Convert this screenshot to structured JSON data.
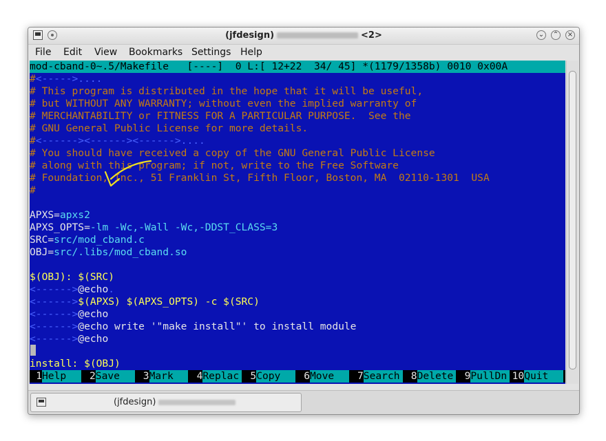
{
  "window": {
    "title_prefix": "(jfdesign)",
    "title_suffix": "<2>"
  },
  "menu": [
    "File",
    "Edit",
    "View",
    "Bookmarks",
    "Settings",
    "Help"
  ],
  "status_line": "mod-cband-0~.5/Makefile   [----]  0 L:[ 12+22  34/ 45] *(1179/1358b) 0010 0x00A",
  "code_lines": [
    [
      {
        "t": "#",
        "c": "org"
      },
      {
        "t": "<----->....",
        "c": "dash"
      }
    ],
    [
      {
        "t": "# This program is distributed in the hope that it will be useful,",
        "c": "org"
      }
    ],
    [
      {
        "t": "# but WITHOUT ANY WARRANTY; without even the implied warranty of",
        "c": "org"
      }
    ],
    [
      {
        "t": "# MERCHANTABILITY or FITNESS FOR A PARTICULAR PURPOSE.  See the",
        "c": "org"
      }
    ],
    [
      {
        "t": "# GNU General Public License for more details.",
        "c": "org"
      }
    ],
    [
      {
        "t": "#",
        "c": "org"
      },
      {
        "t": "<------><------><------>....",
        "c": "dash"
      }
    ],
    [
      {
        "t": "# You should have received a copy of the GNU General Public License",
        "c": "org"
      }
    ],
    [
      {
        "t": "# along with this program; if not, write to the Free Software",
        "c": "org"
      }
    ],
    [
      {
        "t": "# Foundation, Inc., 51 Franklin St, Fifth Floor, Boston, MA  02110-1301  USA",
        "c": "org"
      }
    ],
    [
      {
        "t": "#",
        "c": "org"
      }
    ],
    [],
    [
      {
        "t": "APXS=",
        "c": "white"
      },
      {
        "t": "apxs2",
        "c": "cyan"
      }
    ],
    [
      {
        "t": "APXS_OPTS=",
        "c": "white"
      },
      {
        "t": "-lm -Wc,-Wall -Wc,-DDST_CLASS=3",
        "c": "cyan"
      }
    ],
    [
      {
        "t": "SRC=",
        "c": "white"
      },
      {
        "t": "src/mod_cband.c",
        "c": "cyan"
      }
    ],
    [
      {
        "t": "OBJ=",
        "c": "white"
      },
      {
        "t": "src/.libs/mod_cband.so",
        "c": "cyan"
      }
    ],
    [],
    [
      {
        "t": "$(OBJ): $(SRC)",
        "c": "yel"
      }
    ],
    [
      {
        "t": "<------>",
        "c": "dash"
      },
      {
        "t": "@echo",
        "c": "white"
      },
      {
        "t": ".",
        "c": "dash"
      }
    ],
    [
      {
        "t": "<------>",
        "c": "dash"
      },
      {
        "t": "$(APXS) $(APXS_OPTS) -c $(SRC)",
        "c": "yel"
      }
    ],
    [
      {
        "t": "<------>",
        "c": "dash"
      },
      {
        "t": "@echo",
        "c": "white"
      }
    ],
    [
      {
        "t": "<------>",
        "c": "dash"
      },
      {
        "t": "@echo write '\"make install\"' to install module",
        "c": "white"
      }
    ],
    [
      {
        "t": "<------>",
        "c": "dash"
      },
      {
        "t": "@echo",
        "c": "white"
      }
    ],
    [],
    [
      {
        "t": "install: $(OBJ)",
        "c": "yel"
      }
    ]
  ],
  "function_keys": [
    {
      "num": "1",
      "label": "Help"
    },
    {
      "num": "2",
      "label": "Save"
    },
    {
      "num": "3",
      "label": "Mark"
    },
    {
      "num": "4",
      "label": "Replac"
    },
    {
      "num": "5",
      "label": "Copy"
    },
    {
      "num": "6",
      "label": "Move"
    },
    {
      "num": "7",
      "label": "Search"
    },
    {
      "num": "8",
      "label": "Delete"
    },
    {
      "num": "9",
      "label": "PullDn"
    },
    {
      "num": "10",
      "label": "Quit"
    }
  ],
  "taskbar": {
    "label": "(jfdesign)"
  },
  "icons": [
    "terminal-app-icon",
    "sticky-dot-icon",
    "minimize-icon",
    "maximize-icon",
    "close-icon",
    "terminal-task-icon"
  ],
  "colors": {
    "terminal_bg": "#0a12b3",
    "comment": "#c47b13",
    "status_bg": "#00a9a9",
    "keyword": "#ffff55",
    "value": "#5bdcf0"
  }
}
